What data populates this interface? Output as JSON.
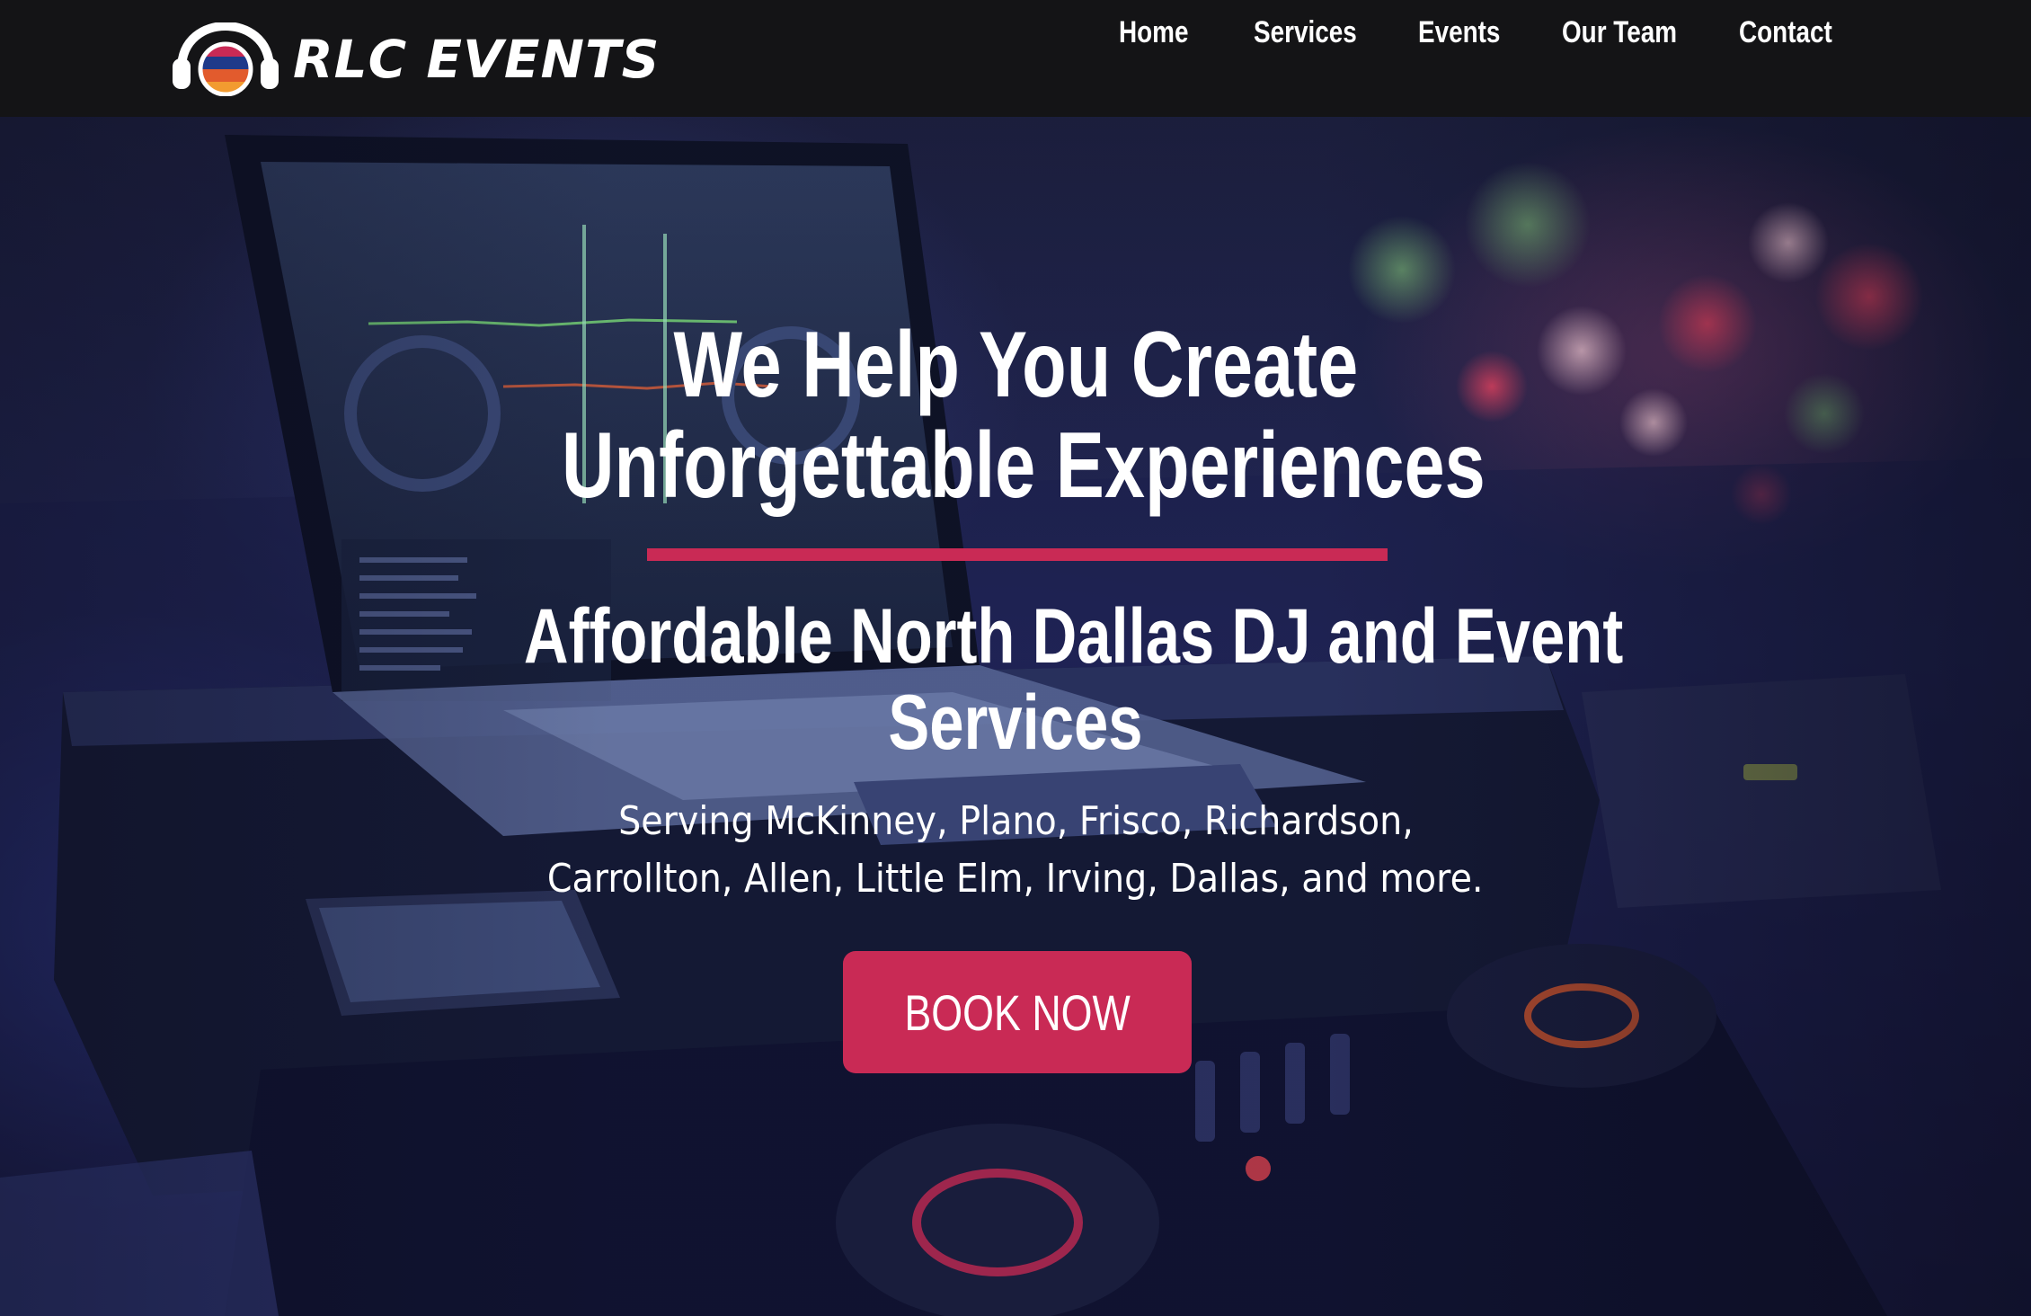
{
  "brand": {
    "name": "RLC EVENTS",
    "logo_icon": "headphones-logo-icon",
    "logo_stripe_colors": [
      "#c92a55",
      "#1f3a8a",
      "#e25b2d",
      "#f29b30"
    ]
  },
  "nav": {
    "items": [
      {
        "label": "Home"
      },
      {
        "label": "Services"
      },
      {
        "label": "Events"
      },
      {
        "label": "Our Team"
      },
      {
        "label": "Contact"
      }
    ]
  },
  "hero": {
    "title_line1": "We Help You Create",
    "title_line2": "Unforgettable Experiences",
    "subtitle_line1": "Affordable North Dallas DJ and Event",
    "subtitle_line2": "Services",
    "areas_line1": "Serving McKinney, Plano, Frisco, Richardson,",
    "areas_line2": "Carrollton, Allen, Little Elm, Irving, Dallas, and more.",
    "cta_label": "BOOK NOW",
    "background_image": "dj-laptop-controller-photo"
  },
  "colors": {
    "accent": "#c92a55",
    "nav_background": "#141416",
    "text": "#ffffff"
  }
}
